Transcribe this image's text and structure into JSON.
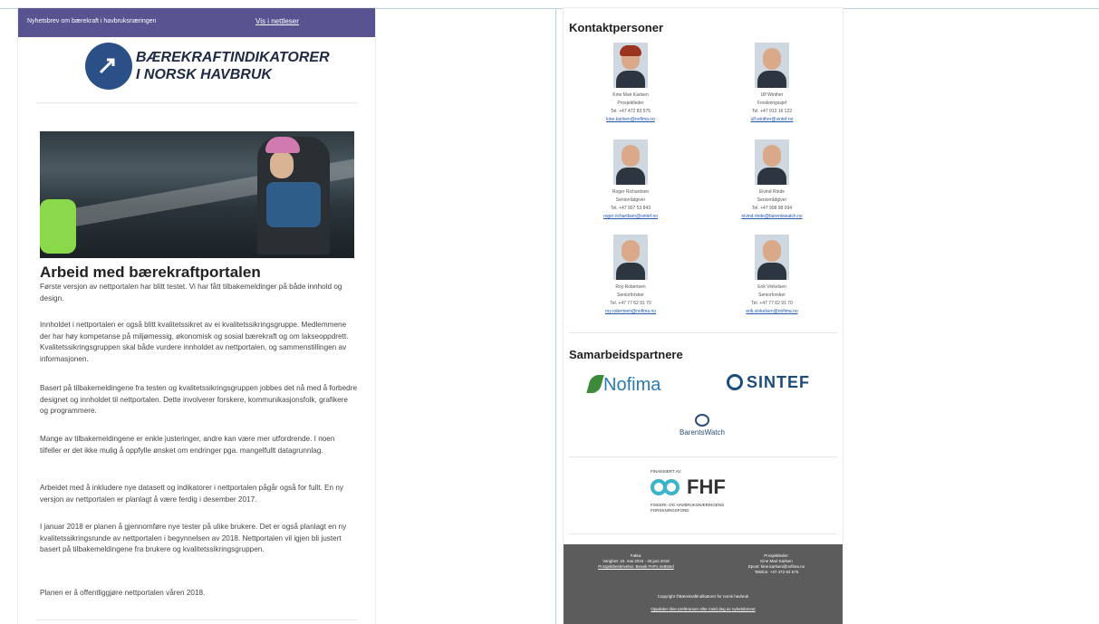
{
  "left": {
    "topbar": {
      "text": "Nyhetsbrev om bærekraft i havbruksnæringen",
      "link": "Vis i nettleser"
    },
    "logo_line1": "BÆREKRAFTINDIKATORER",
    "logo_line2": "I NORSK HAVBRUK",
    "title": "Arbeid med bærekraftportalen",
    "paragraphs": [
      "Første versjon av nettportalen har blitt testet. Vi har fått tilbakemeldinger på både innhold og design.",
      "Innholdet i nettportalen er også blitt kvalitetssikret av ei kvalitetssikringsgruppe. Medlemmene der har høy kompetanse på miljømessig, økonomisk og sosial bærekraft og om lakseoppdrett. Kvalitetssikringsgruppen skal både vurdere innholdet av nettportalen, og sammenstillingen av informasjonen.",
      "Basert på tilbakemeldingene fra testen og kvalitetssikringsgruppen jobbes det nå med å forbedre designet og innholdet til nettportalen. Dette involverer forskere, kommunikasjonsfolk, grafikere og programmere.",
      "Mange av tilbakemeldingene er enkle justeringer, andre kan være mer utfordrende. I noen tilfeller er det ikke mulig å oppfylle ønsket om endringer pga. mangelfullt datagrunnlag.",
      "Arbeidet med å inkludere nye datasett og indikatorer i nettportalen pågår også for fullt. En ny versjon av nettportalen er planlagt å være ferdig i desember 2017.",
      "I januar 2018 er planen å gjennomføre nye tester på ulike brukere. Det er også planlagt en ny kvalitetssikringsrunde av nettportalen i begynnelsen av 2018. Nettportalen vil igjen bli justert basert på tilbakemeldingene fra brukere og kvalitetssikringsgruppen.",
      "Planen er å offentliggjøre nettportalen våren 2018."
    ]
  },
  "right": {
    "contacts_title": "Kontaktpersoner",
    "contacts": [
      {
        "name": "Kine Mari Karlsen",
        "role": "Prosjektleder",
        "phone": "Tel. +47 472 83 575",
        "email": "kine.karlsen@nofima.no"
      },
      {
        "name": "Ulf Winther",
        "role": "Forskningssjef",
        "phone": "Tel. +47 913 16 122",
        "email": "ulf.winther@sintef.no"
      },
      {
        "name": "Roger Richardsen",
        "role": "Seniorrådgiver",
        "phone": "Tel. +47 907 53 843",
        "email": "roger.richardsen@sintef.no"
      },
      {
        "name": "Eivind Rinde",
        "role": "Seniorrådgiver",
        "phone": "Tel. +47 908 98 094",
        "email": "eivind.rinde@barentswatch.no"
      },
      {
        "name": "Roy Robertsen",
        "role": "Seniorforsker",
        "phone": "Tel. +47 77 62 91 70",
        "email": "roy.robertsen@nofima.no"
      },
      {
        "name": "Erik Vinkelsen",
        "role": "Seniorforsker",
        "phone": "Tel. +47 77 62 91 70",
        "email": "erik.vinkelsen@nofima.no"
      }
    ],
    "partners_title": "Samarbeidspartnere",
    "partners": {
      "nofima": "Nofima",
      "sintef": "SINTEF",
      "barentswatch": "BarentsWatch"
    },
    "fhf": {
      "financed": "FINANSIERT AV:",
      "name": "FHF",
      "sub1": "FISKERI- OG HAVBRUKSNÆRINGENS",
      "sub2": "FORSKNINGSFOND"
    },
    "footer": {
      "c1_l1": "Fakta:",
      "c1_l2": "Varighet: 15. mai 2016 - 30.juni 2018",
      "c1_l3": "Prosjektbeskrivelse: Besøk FHFs nettsted",
      "c2_l1": "Prosjektleder:",
      "c2_l2": "Kine Mari Karlsen",
      "c2_l3": "Epost: kine.karlsen@nofima.no",
      "c2_l4": "Telefon: +47 472 83 575",
      "copyright": "Copyright ©Bærekraftindikatorer for norsk havbruk",
      "unsub": "Oppdater dine preferanser eller meld deg av nyhetsbrevet"
    }
  }
}
